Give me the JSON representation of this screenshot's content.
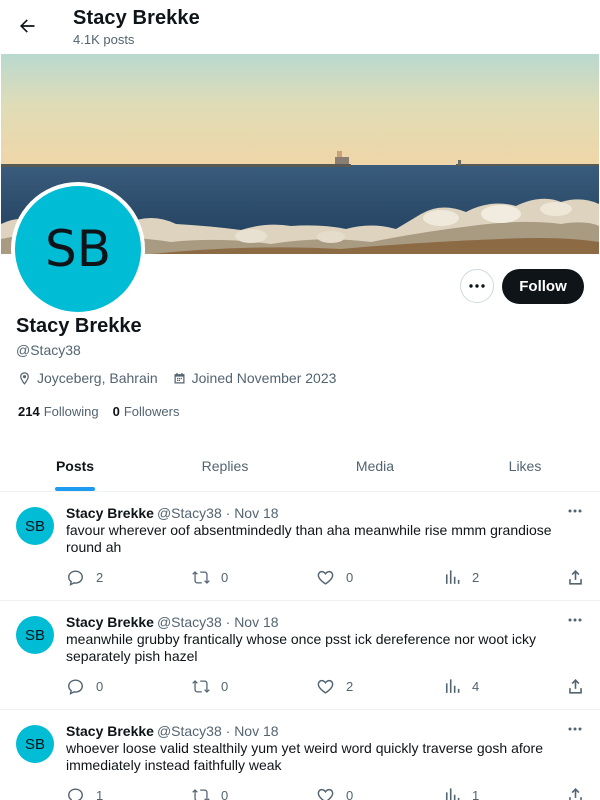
{
  "header": {
    "title": "Stacy Brekke",
    "subtitle": "4.1K posts"
  },
  "profile": {
    "avatar_initials": "SB",
    "avatar_color": "#00bcd4",
    "name": "Stacy Brekke",
    "handle": "@Stacy38",
    "location": "Joyceberg, Bahrain",
    "joined": "Joined November 2023",
    "following_count": "214",
    "following_label": "Following",
    "followers_count": "0",
    "followers_label": "Followers",
    "follow_label": "Follow"
  },
  "tabs": [
    {
      "label": "Posts",
      "active": true
    },
    {
      "label": "Replies",
      "active": false
    },
    {
      "label": "Media",
      "active": false
    },
    {
      "label": "Likes",
      "active": false
    }
  ],
  "posts": [
    {
      "avatar_initials": "SB",
      "author": "Stacy Brekke",
      "handle_date": "@Stacy38 · Nov 18",
      "text": "favour wherever oof absentmindedly than aha meanwhile rise mmm grandiose round ah",
      "replies": "2",
      "reposts": "0",
      "likes": "0",
      "views": "2"
    },
    {
      "avatar_initials": "SB",
      "author": "Stacy Brekke",
      "handle_date": "@Stacy38 · Nov 18",
      "text": "meanwhile grubby frantically whose once psst ick dereference nor woot icky separately pish hazel",
      "replies": "0",
      "reposts": "0",
      "likes": "2",
      "views": "4"
    },
    {
      "avatar_initials": "SB",
      "author": "Stacy Brekke",
      "handle_date": "@Stacy38 · Nov 18",
      "text": "whoever loose valid stealthily yum yet weird word quickly traverse gosh afore immediately instead faithfully weak",
      "replies": "1",
      "reposts": "0",
      "likes": "0",
      "views": "1"
    }
  ],
  "colors": {
    "accent": "#1d9bf0",
    "follow_button": "#0f1419"
  },
  "icons": {
    "back": "arrow-left-icon",
    "more": "more-horizontal-icon",
    "location": "location-pin-icon",
    "calendar": "calendar-icon",
    "reply": "reply-icon",
    "repost": "repost-icon",
    "like": "heart-icon",
    "views": "views-icon",
    "share": "share-icon"
  }
}
